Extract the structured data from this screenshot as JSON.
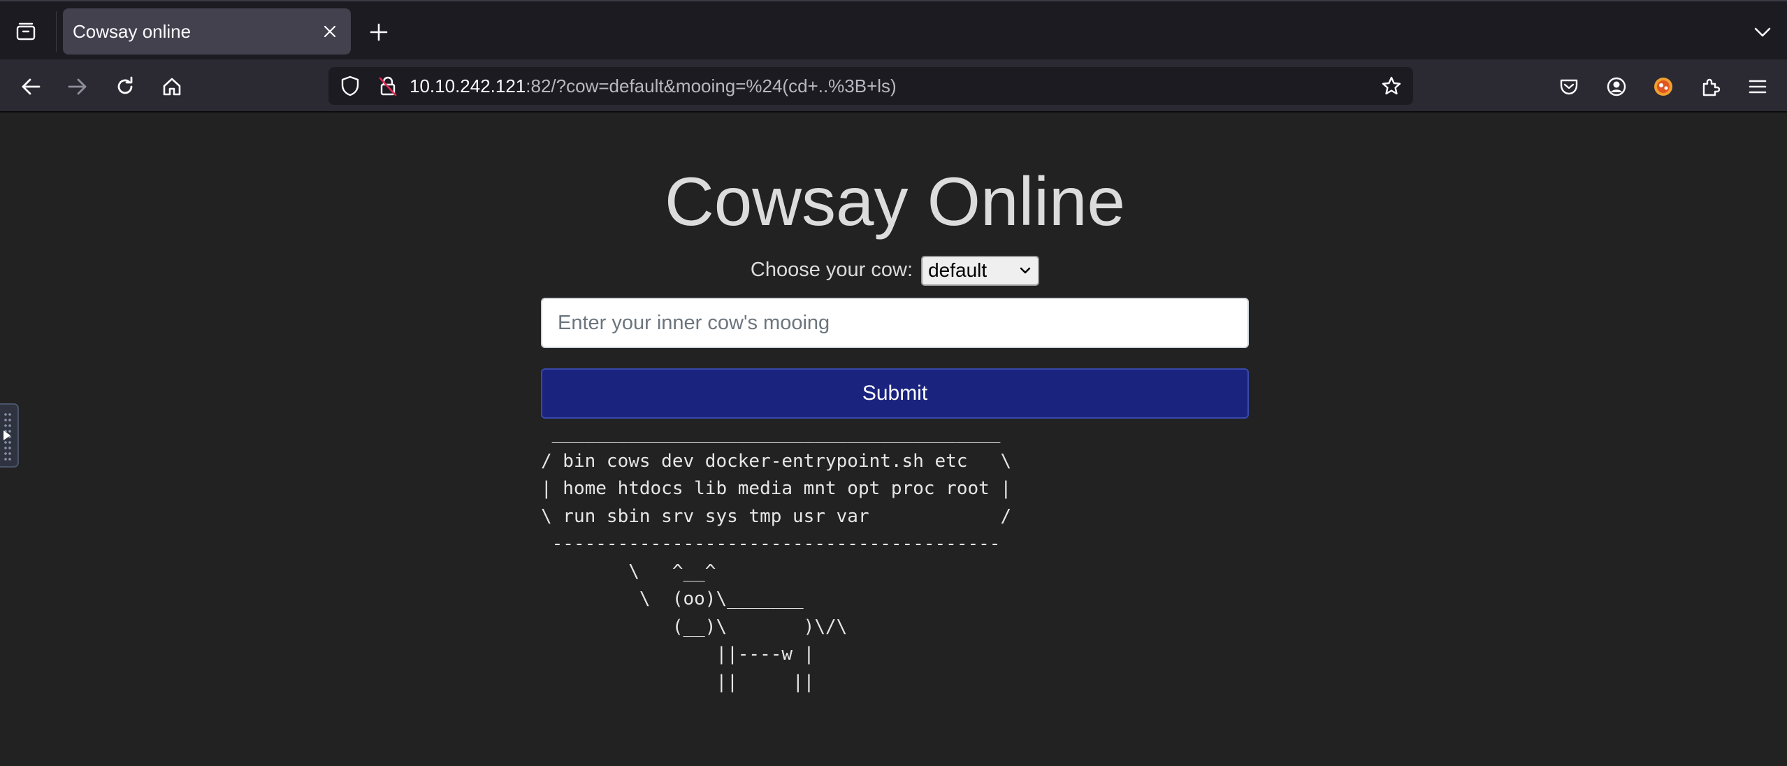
{
  "browser": {
    "tab": {
      "title": "Cowsay online"
    },
    "url": {
      "host": "10.10.242.121",
      "rest": ":82/?cow=default&mooing=%24(cd+..%3B+ls)"
    }
  },
  "icons": {
    "tab_list": "tab-list-icon",
    "close": "close-icon",
    "new_tab": "plus-icon",
    "tabs_menu": "chevron-down-icon",
    "back": "back-arrow-icon",
    "forward": "forward-arrow-icon",
    "reload": "reload-icon",
    "home": "home-icon",
    "tracking": "shield-icon",
    "insecure": "insecure-lock-icon",
    "bookmark": "star-icon",
    "pocket": "pocket-icon",
    "account": "account-icon",
    "extension_fox": "fox-extension-icon",
    "extensions": "puzzle-icon",
    "menu": "hamburger-menu-icon"
  },
  "page": {
    "title": "Cowsay Online",
    "choose_label": "Choose your cow:",
    "cow_selected": "default",
    "mooing_placeholder": "Enter your inner cow's mooing",
    "submit_label": "Submit",
    "cow_output": " _________________________________________\n/ bin cows dev docker-entrypoint.sh etc   \\\n| home htdocs lib media mnt opt proc root |\n\\ run sbin srv sys tmp usr var            /\n -----------------------------------------\n        \\   ^__^\n         \\  (oo)\\_______\n            (__)\\       )\\/\\\n                ||----w |\n                ||     ||"
  },
  "colors": {
    "page_bg": "#222222",
    "submit_bg": "#1a237e",
    "chrome_bg": "#1c1b22",
    "toolbar_bg": "#2b2a33"
  }
}
